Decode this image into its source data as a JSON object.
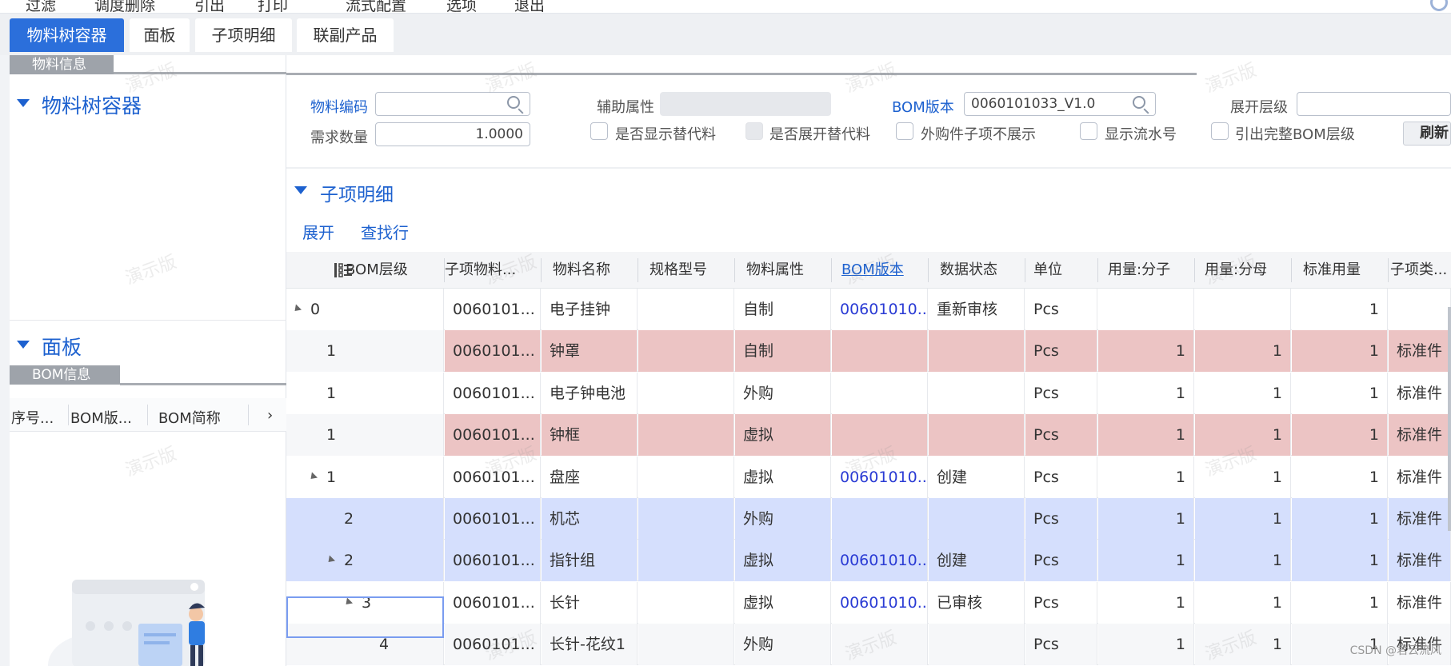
{
  "topbar": {
    "items": [
      "过滤",
      "调度删除",
      "引出",
      "打印",
      "流式配置",
      "选项",
      "退出"
    ]
  },
  "tabs": [
    {
      "label": "物料树容器",
      "active": true
    },
    {
      "label": "面板",
      "active": false
    },
    {
      "label": "子项明细",
      "active": false
    },
    {
      "label": "联副产品",
      "active": false
    }
  ],
  "left": {
    "material_info_tab": "物料信息",
    "tree_title": "物料树容器",
    "panel_title": "面板",
    "bom_info_tab": "BOM信息",
    "columns": [
      "序号...",
      "BOM版...",
      "BOM简称",
      "›"
    ]
  },
  "form": {
    "material_code_label": "物料编码",
    "material_code_value": "",
    "aux_attr_label": "辅助属性",
    "bom_version_label": "BOM版本",
    "bom_version_value": "0060101033_V1.0",
    "expand_level_label": "展开层级",
    "qty_label": "需求数量",
    "qty_value": "1.0000",
    "checkboxes": [
      "是否显示替代料",
      "是否展开替代料",
      "外购件子项不展示",
      "显示流水号",
      "引出完整BOM层级"
    ],
    "refresh_label": "刷新"
  },
  "detail": {
    "title": "子项明细",
    "expand_label": "展开",
    "find_row_label": "查找行"
  },
  "grid": {
    "columns": [
      "BOM层级",
      "子项物料...",
      "物料名称",
      "规格型号",
      "物料属性",
      "BOM版本",
      "数据状态",
      "单位",
      "用量:分子",
      "用量:分母",
      "标准用量",
      "子项类..."
    ],
    "rows": [
      {
        "level": "0",
        "code": "0060101...",
        "name": "电子挂钟",
        "spec": "",
        "attr": "自制",
        "bom": "00601010...",
        "status": "重新审核",
        "unit": "Pcs",
        "num": "",
        "den": "",
        "std": "1",
        "type": ""
      },
      {
        "level": "1",
        "code": "0060101...",
        "name": "钟罩",
        "spec": "",
        "attr": "自制",
        "bom": "",
        "status": "",
        "unit": "Pcs",
        "num": "1",
        "den": "1",
        "std": "1",
        "type": "标准件"
      },
      {
        "level": "1",
        "code": "0060101...",
        "name": "电子钟电池",
        "spec": "",
        "attr": "外购",
        "bom": "",
        "status": "",
        "unit": "Pcs",
        "num": "1",
        "den": "1",
        "std": "1",
        "type": "标准件"
      },
      {
        "level": "1",
        "code": "0060101...",
        "name": "钟框",
        "spec": "",
        "attr": "虚拟",
        "bom": "",
        "status": "",
        "unit": "Pcs",
        "num": "1",
        "den": "1",
        "std": "1",
        "type": "标准件"
      },
      {
        "level": "1",
        "code": "0060101...",
        "name": "盘座",
        "spec": "",
        "attr": "虚拟",
        "bom": "00601010...",
        "status": "创建",
        "unit": "Pcs",
        "num": "1",
        "den": "1",
        "std": "1",
        "type": "标准件"
      },
      {
        "level": "2",
        "code": "0060101...",
        "name": "机芯",
        "spec": "",
        "attr": "外购",
        "bom": "",
        "status": "",
        "unit": "Pcs",
        "num": "1",
        "den": "1",
        "std": "1",
        "type": "标准件"
      },
      {
        "level": "2",
        "code": "0060101...",
        "name": "指针组",
        "spec": "",
        "attr": "虚拟",
        "bom": "00601010...",
        "status": "创建",
        "unit": "Pcs",
        "num": "1",
        "den": "1",
        "std": "1",
        "type": "标准件"
      },
      {
        "level": "3",
        "code": "0060101...",
        "name": "长针",
        "spec": "",
        "attr": "虚拟",
        "bom": "00601010...",
        "status": "已审核",
        "unit": "Pcs",
        "num": "1",
        "den": "1",
        "std": "1",
        "type": "标准件"
      },
      {
        "level": "4",
        "code": "0060101...",
        "name": "长针-花纹1",
        "spec": "",
        "attr": "外购",
        "bom": "",
        "status": "",
        "unit": "Pcs",
        "num": "1",
        "den": "1",
        "std": "1",
        "type": "标准件"
      }
    ]
  },
  "watermark": "演示版",
  "credit": "CSDN @君云流风"
}
